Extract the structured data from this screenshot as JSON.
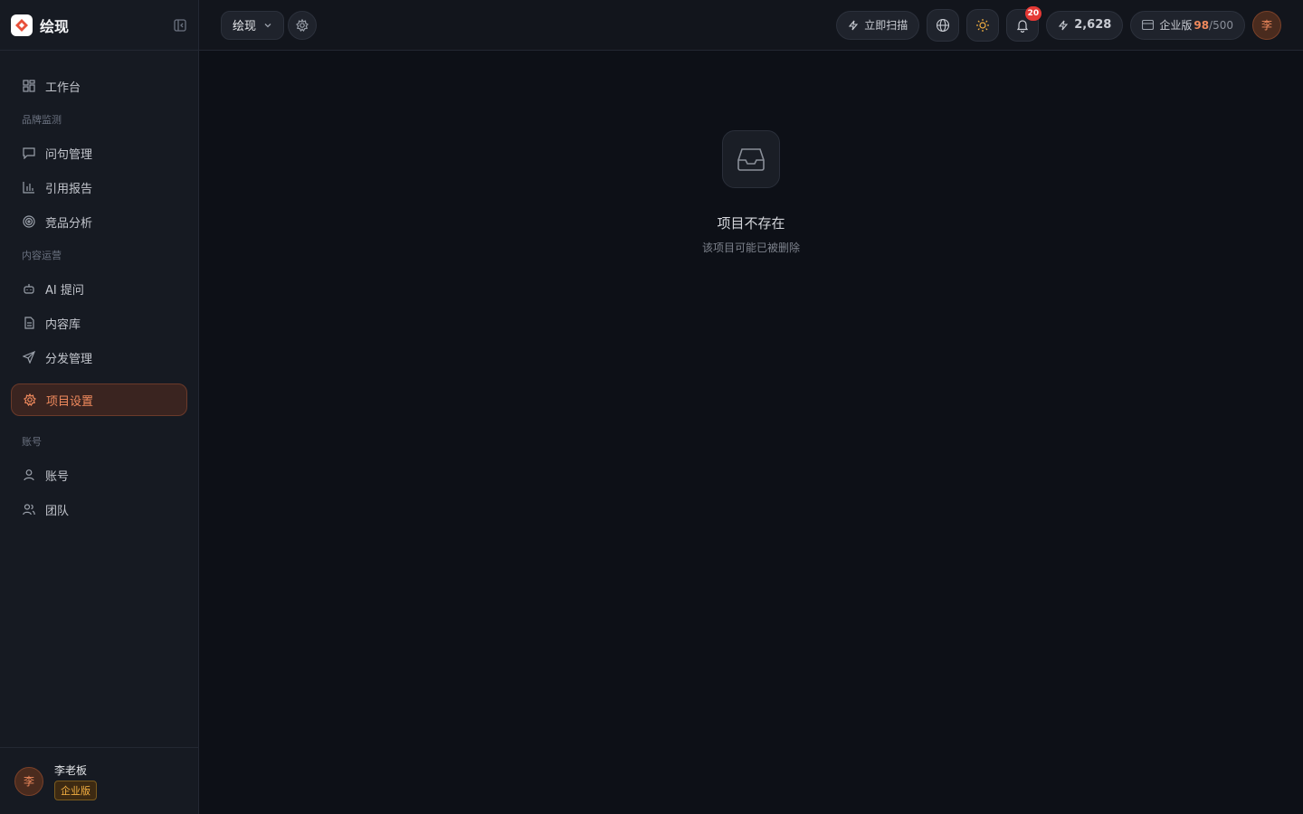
{
  "brand": {
    "name": "绘现",
    "logo_icon": "brand-logo-icon"
  },
  "sidebar": {
    "collapse_icon": "sidebar-collapse-icon",
    "workbench": {
      "label": "工作台",
      "icon": "grid-icon"
    },
    "sections": [
      {
        "label": "品牌监测",
        "items": [
          {
            "label": "问句管理",
            "icon": "message-icon"
          },
          {
            "label": "引用报告",
            "icon": "bar-chart-icon"
          },
          {
            "label": "竞品分析",
            "icon": "target-icon"
          }
        ]
      },
      {
        "label": "内容运营",
        "items": [
          {
            "label": "AI 提问",
            "icon": "bot-icon"
          },
          {
            "label": "内容库",
            "icon": "document-icon"
          },
          {
            "label": "分发管理",
            "icon": "send-icon"
          }
        ]
      }
    ],
    "active_item": {
      "label": "项目设置",
      "icon": "gear-icon"
    },
    "account_section": {
      "label": "账号",
      "items": [
        {
          "label": "账号",
          "icon": "user-icon"
        },
        {
          "label": "团队",
          "icon": "users-icon"
        }
      ]
    },
    "user": {
      "avatar": "李",
      "name": "李老板",
      "plan": "企业版"
    }
  },
  "header": {
    "project": "绘现",
    "scan_label": "立即扫描",
    "notifications_count": "20",
    "credits": "2,628",
    "plan_label": "企业版",
    "quota_used": "98",
    "quota_total": "/500",
    "avatar": "李"
  },
  "main": {
    "empty_title": "项目不存在",
    "empty_subtitle": "该项目可能已被删除"
  },
  "colors": {
    "accent": "#f08a5d",
    "background": "#0d1017",
    "sidebar": "#161a22",
    "badge": "#e53935"
  }
}
